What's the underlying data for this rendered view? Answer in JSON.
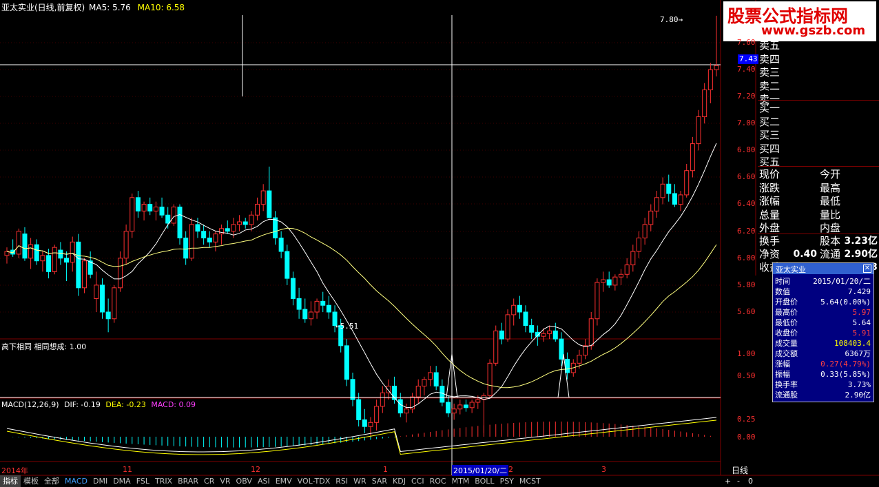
{
  "header": {
    "stock_title": "亚太实业(日线,前复权)",
    "ma5_label": "MA5: 5.76",
    "ma10_label": "MA10: 6.58"
  },
  "watermark": {
    "text": "股票公式指标网",
    "url": "www.gszb.com"
  },
  "price_panel": {
    "price_ticks": [
      "7.60",
      "7.40",
      "7.20",
      "7.00",
      "6.80",
      "6.60",
      "6.40",
      "6.20",
      "6.00",
      "5.80",
      "5.60"
    ],
    "current_price_tag": "7.43",
    "high_annotation": "7.80",
    "low_annotation": "5.51",
    "candles": [
      [
        6.02,
        6.08,
        5.96,
        6.05
      ],
      [
        6.06,
        6.14,
        6.01,
        6.03
      ],
      [
        6.03,
        6.22,
        6.0,
        6.2
      ],
      [
        6.18,
        6.23,
        5.98,
        6.0
      ],
      [
        6.0,
        6.15,
        5.92,
        6.1
      ],
      [
        6.1,
        6.14,
        5.95,
        5.98
      ],
      [
        5.98,
        6.05,
        5.9,
        6.02
      ],
      [
        6.02,
        6.07,
        5.85,
        5.9
      ],
      [
        5.9,
        6.1,
        5.88,
        6.08
      ],
      [
        6.06,
        6.12,
        5.95,
        6.0
      ],
      [
        6.0,
        6.05,
        5.83,
        5.97
      ],
      [
        5.97,
        6.16,
        5.9,
        6.12
      ],
      [
        6.12,
        6.18,
        5.72,
        5.78
      ],
      [
        5.78,
        6.0,
        5.74,
        5.98
      ],
      [
        5.98,
        6.05,
        5.85,
        5.88
      ],
      [
        5.7,
        5.9,
        5.6,
        5.8
      ],
      [
        5.8,
        5.85,
        5.55,
        5.6
      ],
      [
        5.6,
        5.7,
        5.45,
        5.55
      ],
      [
        5.55,
        5.8,
        5.52,
        5.78
      ],
      [
        5.78,
        6.05,
        5.75,
        6.0
      ],
      [
        6.0,
        6.25,
        5.95,
        6.2
      ],
      [
        6.2,
        6.48,
        6.15,
        6.45
      ],
      [
        6.45,
        6.5,
        6.3,
        6.35
      ],
      [
        6.35,
        6.42,
        6.28,
        6.4
      ],
      [
        6.4,
        6.45,
        6.32,
        6.35
      ],
      [
        6.35,
        6.42,
        6.28,
        6.38
      ],
      [
        6.38,
        6.45,
        6.3,
        6.32
      ],
      [
        6.32,
        6.38,
        6.22,
        6.26
      ],
      [
        6.26,
        6.4,
        6.24,
        6.38
      ],
      [
        6.38,
        6.4,
        6.1,
        6.15
      ],
      [
        6.15,
        6.2,
        5.95,
        6.0
      ],
      [
        6.0,
        6.3,
        5.98,
        6.25
      ],
      [
        6.25,
        6.3,
        6.15,
        6.2
      ],
      [
        6.2,
        6.25,
        6.1,
        6.15
      ],
      [
        6.15,
        6.2,
        6.08,
        6.12
      ],
      [
        6.12,
        6.2,
        6.05,
        6.18
      ],
      [
        6.18,
        6.25,
        6.1,
        6.22
      ],
      [
        6.22,
        6.28,
        6.18,
        6.2
      ],
      [
        6.2,
        6.3,
        6.15,
        6.25
      ],
      [
        6.25,
        6.32,
        6.2,
        6.27
      ],
      [
        6.27,
        6.3,
        6.22,
        6.25
      ],
      [
        6.25,
        6.35,
        6.2,
        6.32
      ],
      [
        6.32,
        6.45,
        6.28,
        6.4
      ],
      [
        6.4,
        6.55,
        6.35,
        6.5
      ],
      [
        6.5,
        6.68,
        6.45,
        6.3
      ],
      [
        6.3,
        6.35,
        6.1,
        6.15
      ],
      [
        6.15,
        6.2,
        6.0,
        6.05
      ],
      [
        6.05,
        6.1,
        5.8,
        5.85
      ],
      [
        5.85,
        5.9,
        5.65,
        5.7
      ],
      [
        5.7,
        5.78,
        5.55,
        5.62
      ],
      [
        5.62,
        5.7,
        5.52,
        5.55
      ],
      [
        5.55,
        5.68,
        5.5,
        5.6
      ],
      [
        5.6,
        5.7,
        5.55,
        5.68
      ],
      [
        5.68,
        5.75,
        5.6,
        5.65
      ],
      [
        5.65,
        5.72,
        5.55,
        5.6
      ],
      [
        5.6,
        5.65,
        5.45,
        5.5
      ],
      [
        5.5,
        5.55,
        5.3,
        5.35
      ],
      [
        5.35,
        5.4,
        5.05,
        5.1
      ],
      [
        5.1,
        5.15,
        4.9,
        4.95
      ],
      [
        4.95,
        5.0,
        4.75,
        4.8
      ],
      [
        4.8,
        4.88,
        4.7,
        4.75
      ],
      [
        4.75,
        4.82,
        4.68,
        4.78
      ],
      [
        4.78,
        4.95,
        4.72,
        4.9
      ],
      [
        4.9,
        5.05,
        4.85,
        5.0
      ],
      [
        5.0,
        5.1,
        4.95,
        5.05
      ],
      [
        5.05,
        5.12,
        4.92,
        4.95
      ],
      [
        4.95,
        5.0,
        4.82,
        4.85
      ],
      [
        4.85,
        4.92,
        4.78,
        4.88
      ],
      [
        4.88,
        5.0,
        4.85,
        4.97
      ],
      [
        4.97,
        5.1,
        4.92,
        5.05
      ],
      [
        5.05,
        5.12,
        4.98,
        5.1
      ],
      [
        5.1,
        5.2,
        5.05,
        5.15
      ],
      [
        5.15,
        5.2,
        5.02,
        5.05
      ],
      [
        5.05,
        5.1,
        4.9,
        4.93
      ],
      [
        4.93,
        4.98,
        4.82,
        4.85
      ],
      [
        4.85,
        4.92,
        4.8,
        4.88
      ],
      [
        4.88,
        4.95,
        4.84,
        4.91
      ],
      [
        4.91,
        4.95,
        4.86,
        4.89
      ],
      [
        4.89,
        4.95,
        4.85,
        4.93
      ],
      [
        4.93,
        4.98,
        4.88,
        4.95
      ],
      [
        4.95,
        5.0,
        4.7,
        4.98
      ],
      [
        4.98,
        5.25,
        4.96,
        5.22
      ],
      [
        5.22,
        5.5,
        5.2,
        5.46
      ],
      [
        5.46,
        5.52,
        5.36,
        5.4
      ],
      [
        5.4,
        5.62,
        5.38,
        5.58
      ],
      [
        5.58,
        5.7,
        5.5,
        5.65
      ],
      [
        5.65,
        5.72,
        5.55,
        5.6
      ],
      [
        5.6,
        5.65,
        5.45,
        5.5
      ],
      [
        5.5,
        5.55,
        5.4,
        5.45
      ],
      [
        5.45,
        5.5,
        5.35,
        5.42
      ],
      [
        5.42,
        5.48,
        5.38,
        5.44
      ],
      [
        5.44,
        5.5,
        5.4,
        5.46
      ],
      [
        5.46,
        5.52,
        5.38,
        5.4
      ],
      [
        5.4,
        5.45,
        5.2,
        5.25
      ],
      [
        5.25,
        5.3,
        5.1,
        5.15
      ],
      [
        5.15,
        5.25,
        5.12,
        5.22
      ],
      [
        5.22,
        5.32,
        5.18,
        5.28
      ],
      [
        5.28,
        5.4,
        5.25,
        5.35
      ],
      [
        5.35,
        5.6,
        5.32,
        5.55
      ],
      [
        5.55,
        5.85,
        5.5,
        5.82
      ],
      [
        5.82,
        5.9,
        5.75,
        5.84
      ],
      [
        5.84,
        5.9,
        5.78,
        5.8
      ],
      [
        5.8,
        5.88,
        5.76,
        5.86
      ],
      [
        5.86,
        5.92,
        5.8,
        5.88
      ],
      [
        5.88,
        6.0,
        5.85,
        5.95
      ],
      [
        5.95,
        6.1,
        5.9,
        6.05
      ],
      [
        6.05,
        6.2,
        6.0,
        6.15
      ],
      [
        6.15,
        6.3,
        6.1,
        6.25
      ],
      [
        6.25,
        6.4,
        6.2,
        6.35
      ],
      [
        6.35,
        6.5,
        6.3,
        6.45
      ],
      [
        6.45,
        6.6,
        6.4,
        6.55
      ],
      [
        6.55,
        6.62,
        6.42,
        6.48
      ],
      [
        6.48,
        6.55,
        6.38,
        6.4
      ],
      [
        6.4,
        6.5,
        6.35,
        6.47
      ],
      [
        6.47,
        6.7,
        6.45,
        6.65
      ],
      [
        6.65,
        6.9,
        6.6,
        6.85
      ],
      [
        6.85,
        7.1,
        6.8,
        7.05
      ],
      [
        7.05,
        7.3,
        7.0,
        7.25
      ],
      [
        7.25,
        7.45,
        7.15,
        7.4
      ],
      [
        7.4,
        7.8,
        7.35,
        7.43
      ]
    ]
  },
  "indicator1": {
    "title": "高下相同 相同想成: 1.00",
    "ticks": [
      "1.00",
      "0.50"
    ]
  },
  "macd": {
    "title": "MACD(12,26,9)",
    "dif": "DIF: -0.19",
    "dea": "DEA: -0.23",
    "macd": "MACD: 0.09",
    "ticks": [
      "0.25",
      "0.00"
    ]
  },
  "date_axis": {
    "labels": [
      "2014年",
      "11",
      "12",
      "1",
      "2",
      "3"
    ],
    "selected_date": "2015/01/20/二"
  },
  "quote_panel": {
    "sell_labels": [
      "卖五",
      "卖四",
      "卖三",
      "卖二",
      "卖一"
    ],
    "buy_labels": [
      "买一",
      "买二",
      "买三",
      "买四",
      "买五"
    ],
    "stat_rows": [
      {
        "l1": "现价",
        "l2": "今开"
      },
      {
        "l1": "涨跌",
        "l2": "最高"
      },
      {
        "l1": "涨幅",
        "l2": "最低"
      },
      {
        "l1": "总量",
        "l2": "量比"
      },
      {
        "l1": "外盘",
        "l2": "内盘"
      }
    ],
    "turnover_label": "换手",
    "float_capital_label": "股本",
    "float_capital_value": "3.23亿",
    "net_assets_label": "净资",
    "net_assets_value": "0.40",
    "circulating_label": "流通",
    "circulating_value": "2.90亿",
    "income_label": "收益",
    "income_value": "3"
  },
  "info_popup": {
    "title": "亚太实业",
    "close_icon": "close-icon",
    "rows": [
      {
        "k": "时间",
        "v": "2015/01/20/二",
        "c": "#ffffff"
      },
      {
        "k": "数值",
        "v": "7.429",
        "c": "#ffffff"
      },
      {
        "k": "开盘价",
        "v": "5.64(0.00%)",
        "c": "#ffffff"
      },
      {
        "k": "最高价",
        "v": "5.97",
        "c": "#ff4040"
      },
      {
        "k": "最低价",
        "v": "5.64",
        "c": "#ffffff"
      },
      {
        "k": "收盘价",
        "v": "5.91",
        "c": "#ff4040"
      },
      {
        "k": "成交量",
        "v": "108403.4",
        "c": "#ffff00"
      },
      {
        "k": "成交额",
        "v": "6367万",
        "c": "#ffffff"
      },
      {
        "k": "涨幅",
        "v": "0.27(4.79%)",
        "c": "#ff4040"
      },
      {
        "k": "振幅",
        "v": "0.33(5.85%)",
        "c": "#ffffff"
      },
      {
        "k": "换手率",
        "v": "3.73%",
        "c": "#ffffff"
      },
      {
        "k": "流通股",
        "v": "2.90亿",
        "c": "#ffffff"
      }
    ]
  },
  "toolbar": {
    "tabs": [
      "指标",
      "模板",
      "全部",
      "MACD",
      "DMI",
      "DMA",
      "FSL",
      "TRIX",
      "BRAR",
      "CR",
      "VR",
      "OBV",
      "ASI",
      "EMV",
      "VOL-TDX",
      "RSI",
      "WR",
      "SAR",
      "KDJ",
      "CCI",
      "ROC",
      "MTM",
      "BOLL",
      "PSY",
      "MCST"
    ],
    "active_index": 3,
    "period": "日线",
    "zoom_in": "+",
    "zoom_out": "-",
    "zoom_value": "0"
  },
  "colors": {
    "up": "#ff3030",
    "down": "#00ffff",
    "ma_fast": "#ffffff",
    "ma_slow": "#ffff80",
    "grid": "#800000",
    "axis_text": "#ff3030"
  }
}
